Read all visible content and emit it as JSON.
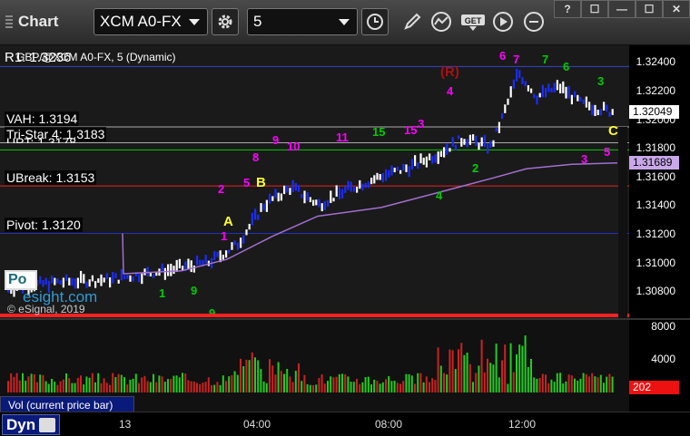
{
  "toolbar": {
    "app_title": "Chart",
    "symbol": "XCM A0-FX",
    "interval": "5",
    "window_buttons": [
      "?",
      "☐",
      "—",
      "☐",
      "✕"
    ]
  },
  "chart": {
    "header": "GBP/@XCM A0-FX, 5 (Dynamic)",
    "header_overlap": "R1: 1.3236",
    "copyright": "© eSignal, 2019",
    "watermark_box": "Po",
    "watermark_text": "esight.com",
    "price_axis": [
      "1.32400",
      "1.32200",
      "1.32000",
      "1.31800",
      "1.31600",
      "1.31400",
      "1.31200",
      "1.31000",
      "1.30800"
    ],
    "current_price": "1.32049",
    "ma_price": "1.31689",
    "levels": [
      {
        "label": "VAH: 1.3194",
        "color": "#ffffff"
      },
      {
        "label": "Tri-Star 4: 1.3183",
        "color": "#ffffff"
      },
      {
        "label": "UPT: 1.3178",
        "color": "#00ff00"
      },
      {
        "label": "UBreak: 1.3153",
        "color": "#ff3333"
      },
      {
        "label": "Pivot: 1.3120",
        "color": "#3355ff"
      }
    ],
    "marks": {
      "A": "A",
      "B": "B",
      "C": "C",
      "R": "(R)"
    },
    "colors": {
      "up": "#ffffff",
      "down": "#1a2cff",
      "ma": "#a070d0",
      "count_green": "#00cc00",
      "count_magenta": "#ff00ff"
    }
  },
  "volume": {
    "caption": "Vol (current price bar)",
    "axis": [
      "8000",
      "4000",
      "0"
    ],
    "current": "202"
  },
  "time_axis": {
    "dyn_label": "Dyn",
    "labels": [
      "13",
      "04:00",
      "08:00",
      "12:00"
    ]
  }
}
